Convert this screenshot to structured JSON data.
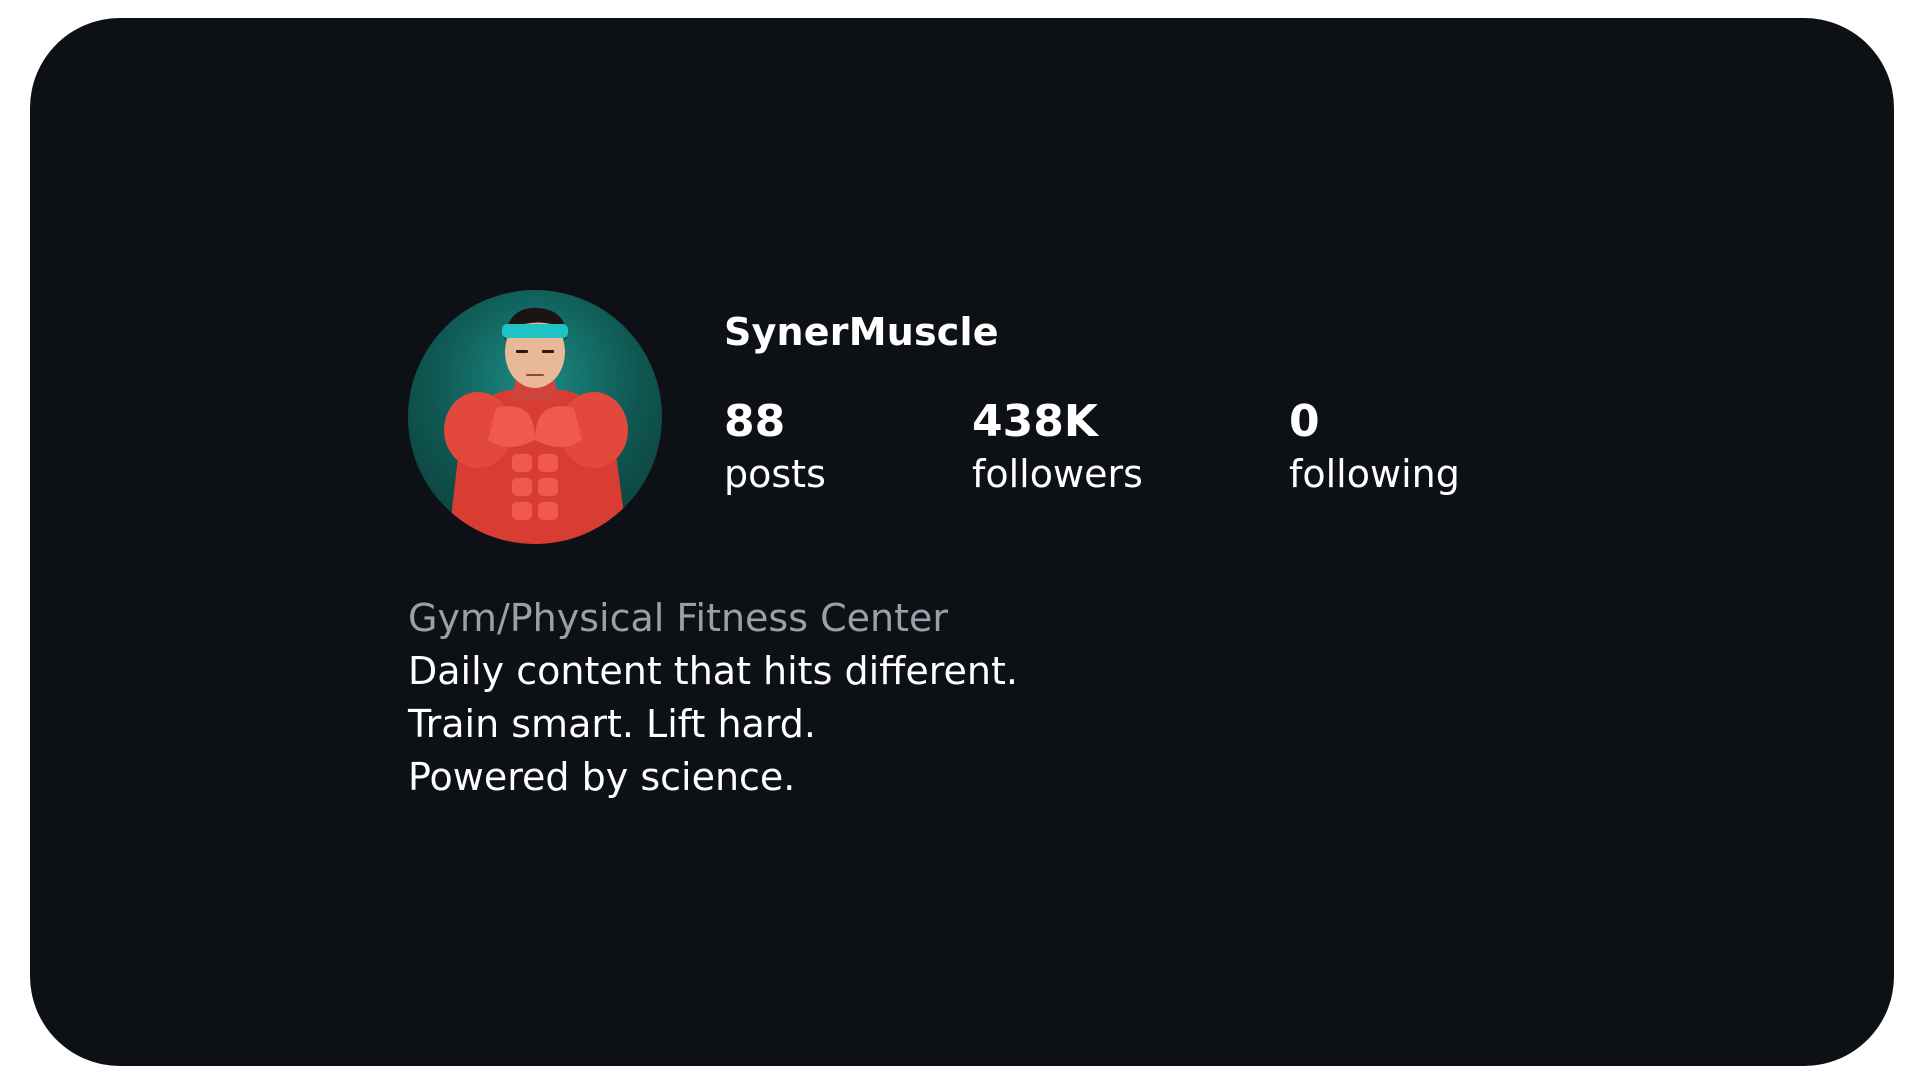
{
  "profile": {
    "username": "SynerMuscle",
    "avatar_alt": "muscular-figure-with-headband"
  },
  "stats": {
    "posts": {
      "value": "88",
      "label": "posts"
    },
    "followers": {
      "value": "438K",
      "label": "followers"
    },
    "following": {
      "value": "0",
      "label": "following"
    }
  },
  "bio": {
    "category": "Gym/Physical Fitness Center",
    "lines": [
      "Daily content that hits different.",
      "Train smart. Lift hard.",
      "Powered by science."
    ]
  },
  "colors": {
    "background": "#0d1015",
    "text": "#ffffff",
    "category_text": "#9aa0a8",
    "avatar_bg": "#0f5752",
    "muscle": "#e2483c",
    "headband": "#1fc3c3"
  }
}
